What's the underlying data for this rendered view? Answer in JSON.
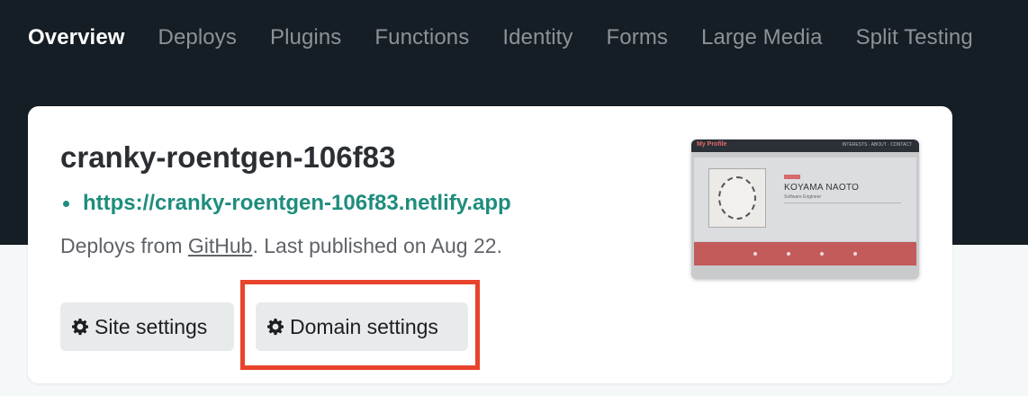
{
  "nav": {
    "items": [
      {
        "label": "Overview",
        "active": true
      },
      {
        "label": "Deploys",
        "active": false
      },
      {
        "label": "Plugins",
        "active": false
      },
      {
        "label": "Functions",
        "active": false
      },
      {
        "label": "Identity",
        "active": false
      },
      {
        "label": "Forms",
        "active": false
      },
      {
        "label": "Large Media",
        "active": false
      },
      {
        "label": "Split Testing",
        "active": false
      }
    ]
  },
  "site": {
    "name": "cranky-roentgen-106f83",
    "url": "https://cranky-roentgen-106f83.netlify.app",
    "deploy_prefix": "Deploys from ",
    "deploy_source": "GitHub",
    "deploy_suffix": ". Last published on Aug 22."
  },
  "buttons": {
    "site_settings": "Site settings",
    "domain_settings": "Domain settings"
  },
  "preview": {
    "header_title": "My Profile",
    "menu": "INTERESTS · ABOUT · CONTACT",
    "name": "KOYAMA NAOTO",
    "role": "Software Engineer"
  },
  "colors": {
    "header_bg": "#151e25",
    "accent": "#1e8d7d",
    "highlight": "#e8432b"
  }
}
